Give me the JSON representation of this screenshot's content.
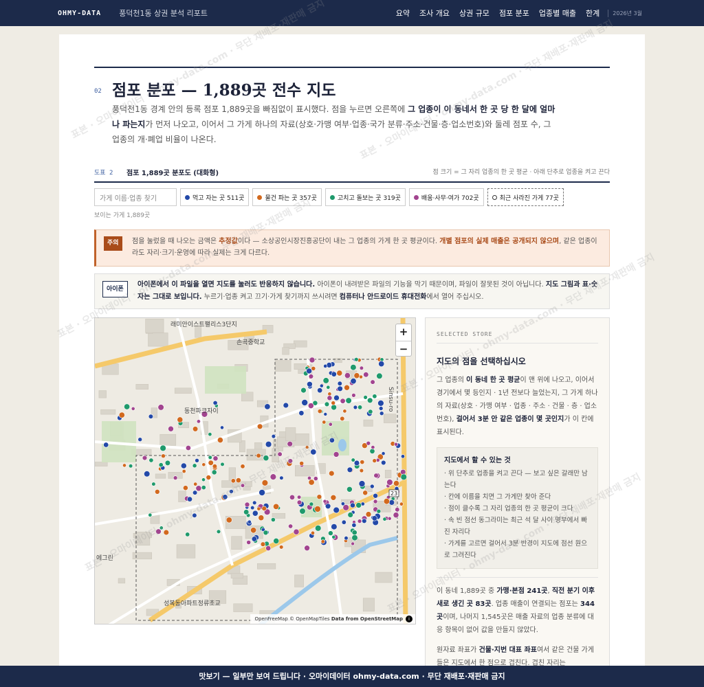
{
  "topbar": {
    "brand": "OHMY-DATA",
    "report_title": "풍덕천1동 상권 분석 리포트",
    "nav": [
      "요약",
      "조사 개요",
      "상권 규모",
      "점포 분포",
      "업종별 매출",
      "한계"
    ],
    "date": "2026년 3월"
  },
  "section": {
    "number": "02",
    "title": "점포 분포 — 1,889곳 전수 지도",
    "intro_1": "풍덕천1동 경계 안의 등록 점포 1,889곳을 빠짐없이 표시했다. 점을 누르면 오른쪽에 ",
    "intro_b1": "그 업종이 이 동네서 한 곳 당 한 달에 얼마나 파는지",
    "intro_2": "가 먼저 나오고, 이어서 그 가게 하나의 자료(상호·가맹 여부·업종·국가 분류·주소·건물·층·업소번호)와 둘레 점포 수, 그 업종의 개·폐업 비율이 나온다."
  },
  "figure": {
    "label": "도표 2",
    "title": "점포 1,889곳 분포도 (대화형)",
    "note": "점 크기 = 그 자리 업종의 한 곳 평균 · 아래 단추로 업종을 켜고 끈다"
  },
  "filters": {
    "search_placeholder": "가게 이름·업종 찾기",
    "chips": [
      {
        "label": "먹고 자는 곳 511곳",
        "color": "#2349a8"
      },
      {
        "label": "물건 파는 곳 357곳",
        "color": "#d2691e"
      },
      {
        "label": "고치고 돌보는 곳 319곳",
        "color": "#1f9a6c"
      },
      {
        "label": "배움·사무·여가 702곳",
        "color": "#a2448f"
      }
    ],
    "closed_chip": "최근 사라진 가게 77곳",
    "visible": "보이는 가게 1,889곳"
  },
  "warning": {
    "tag": "주의",
    "t1": "점을 눌렀을 때 나오는 금액은 ",
    "t1b": "추정값",
    "t2": "이다 — 소상공인시장진흥공단이 내는 그 업종의 가게 한 곳 평균이다. ",
    "hl": "개별 점포의 실제 매출은 공개되지 않으며",
    "t3": ", 같은 업종이라도 자리·크기·운영에 따라 실제는 크게 다르다."
  },
  "ios": {
    "tag": "아이폰",
    "b1": "아이폰에서 이 파일을 열면 지도를 눌러도 반응하지 않습니다.",
    "t1": " 아이폰이 내려받은 파일의 기능을 막기 때문이며, 파일이 잘못된 것이 아닙니다. ",
    "b2": "지도 그림과 표·숫자는 그대로 보입니다.",
    "t2": " 누르기·업종 켜고 끄기·가게 찾기까지 쓰시려면 ",
    "b3": "컴퓨터나 안드로이드 휴대전화",
    "t3": "에서 열어 주십시오."
  },
  "map": {
    "attribution_pre": "OpenFreeMap © OpenMapTiles ",
    "attribution_b": "Data from OpenStreetMap",
    "zoom_in": "+",
    "zoom_out": "−",
    "labels": [
      "래미안이스트팰리스3단지",
      "손곡중학교",
      "동천파크자이",
      "성복동아파트정류초교",
      "에그린",
      "Sinsu-ro",
      "23"
    ]
  },
  "panel": {
    "tag": "SELECTED STORE",
    "title": "지도의 점을 선택하십시오",
    "p1a": "그 업종의 ",
    "p1b": "이 동네 한 곳 평균",
    "p1c": "이 맨 위에 나오고, 이어서 경기에서 몇 등인지 · 1년 전보다 늘었는지, 그 가게 하나의 자료(상호 · 가맹 여부 · 업종 · 주소 · 건물 · 층 · 업소번호), ",
    "p1d": "걸어서 3분 안 같은 업종이 몇 곳인지",
    "p1e": "가 이 칸에 표시된다.",
    "how_title": "지도에서 할 수 있는 것",
    "how": [
      "· 위 단추로 업종을 켜고 끈다 — 보고 싶은 갈래만 남는다",
      "· 칸에 이름을 치면 그 가게만 찾아 준다",
      "· 점이 클수록 그 자리 업종의 한 곳 평균이 크다",
      "· 속 빈 점선 동그라미는 최근 석 달 사이 명부에서 빠진 자리다",
      "· 가게를 고르면 걸어서 3분 반경이 지도에 점선 원으로 그려진다"
    ],
    "s1": "이 동네 1,889곳 중 ",
    "s1b": "가맹·본점 241곳",
    "s2": ", ",
    "s2b": "직전 분기 이후 새로 생긴 곳 83곳",
    "s3": ". 업종 매출이 연결되는 점포는 ",
    "s3b": "344곳",
    "s4": "이며, 나머지 1,545곳은 매출 자료의 업종 분류에 대응 항목이 없어 값을 만들지 않았다.",
    "s5": "원자료 좌표가 ",
    "s5b": "건물·지번 대표 좌표",
    "s6": "여서 같은 건물 가게들은 지도에서 한 점으로 겹친다. 겹친 자리는"
  },
  "bottom": "맛보기 — 일부만 보여 드립니다 · 오마이데이터 ohmy-data.com · 무단 재배포·재판매 금지",
  "watermark": [
    "표본 · 오마이데이터 · ohmy-data.com · 무단 재배포·재판매 금지"
  ]
}
